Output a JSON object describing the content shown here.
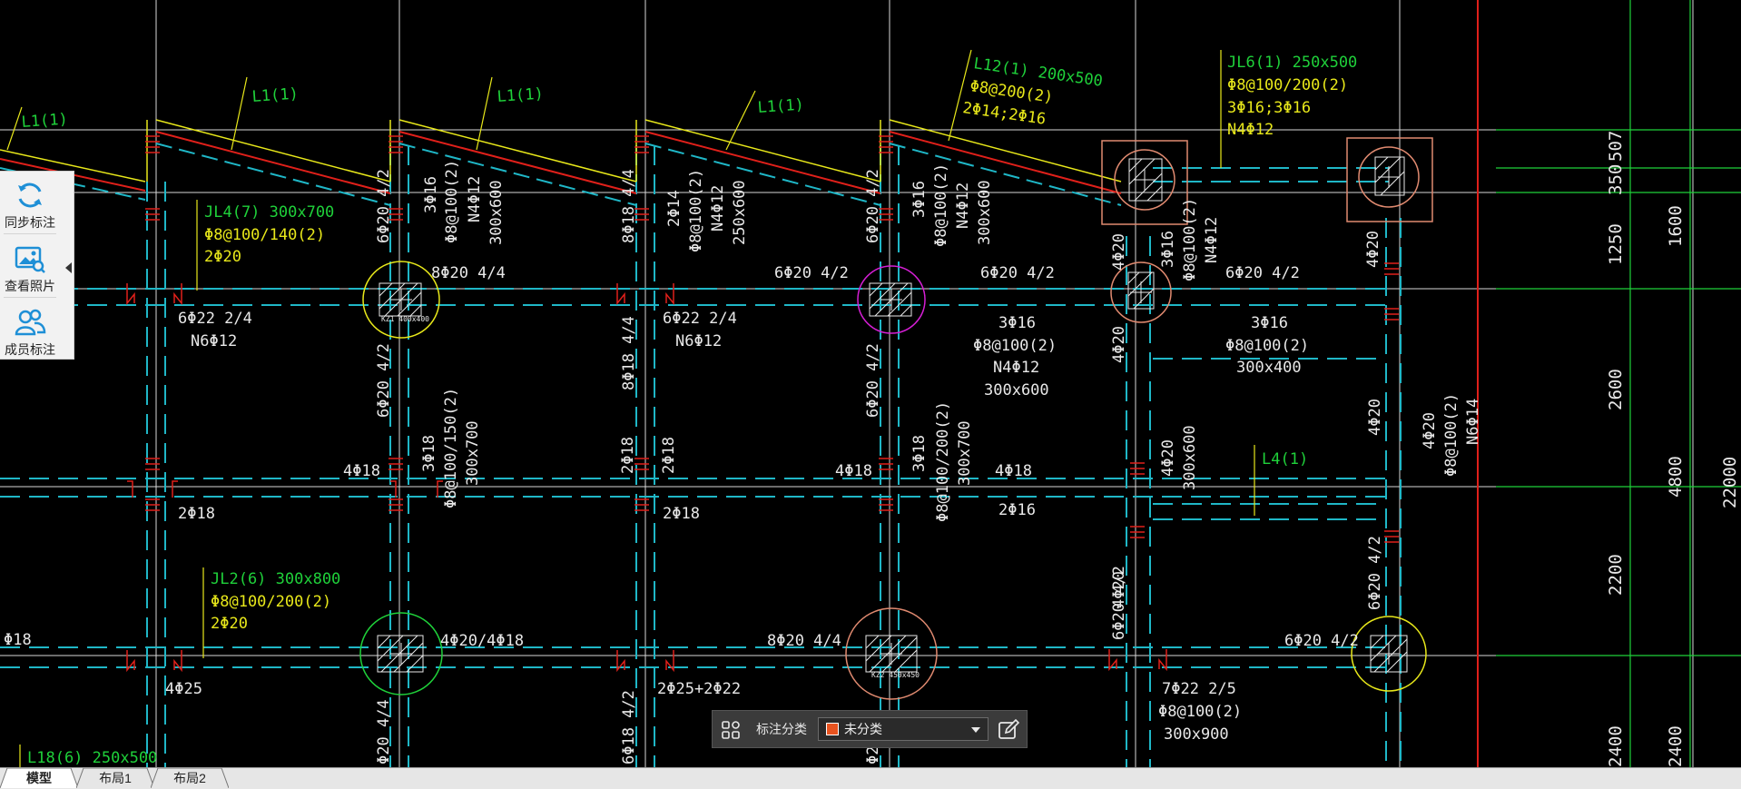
{
  "toolbar": {
    "sync_label": "同步标注",
    "photo_label": "查看照片",
    "member_label": "成员标注"
  },
  "tabs": [
    {
      "label": "模型",
      "active": true
    },
    {
      "label": "布局1",
      "active": false
    },
    {
      "label": "布局2",
      "active": false
    }
  ],
  "annotation_bar": {
    "label": "标注分类",
    "selected": "未分类",
    "swatch_color": "#e8531f"
  },
  "drawing": {
    "beam_tags": {
      "l1a": "L1(1)",
      "l1b": "L1(1)",
      "l1c": "L1(1)",
      "l1d": "L1(1)",
      "l12": [
        "L12(1) 200x500",
        "Φ8@200(2)",
        "2Φ14;2Φ16"
      ],
      "jl6": [
        "JL6(1) 250x500",
        "Φ8@100/200(2)",
        "3Φ16;3Φ16",
        "N4Φ12"
      ],
      "jl4": [
        "JL4(7) 300x700",
        "Φ8@100/140(2)",
        "2Φ20"
      ],
      "jl2": [
        "JL2(6) 300x800",
        "Φ8@100/200(2)",
        "2Φ20"
      ],
      "l4": "L4(1)",
      "l18": "L18(6) 250x500"
    },
    "labels": {
      "t1": "8Φ20 4/4",
      "t2": "6Φ20 4/2",
      "t3": "6Φ20 4/2",
      "t4": "6Φ20 4/2",
      "t5": "6Φ22 2/4",
      "t6": "N6Φ12",
      "t7": "6Φ22 2/4",
      "t8": "N6Φ12",
      "t9": "3Φ16",
      "t10": "Φ8@100(2)",
      "t11": "N4Φ12",
      "t12": "300x600",
      "t13": "3Φ16",
      "t14": "Φ8@100(2)",
      "t15": "300x400",
      "t16": "4Φ18",
      "t17": "2Φ18",
      "t18": "4Φ18",
      "t19": "2Φ18",
      "t20": "4Φ18",
      "t21": "2Φ16",
      "t22": "4Φ20/4Φ18",
      "t23": "8Φ20 4/4",
      "t24": "6Φ20 4/2",
      "t25": "4Φ25",
      "t26": "2Φ25+2Φ22",
      "t27": "7Φ22 2/5",
      "t28": "Φ8@100(2)",
      "t29": "300x900",
      "t30": "Φ18",
      "v1": "6Φ20 4/2",
      "v2": "3Φ16",
      "v3": "Φ8@100(2)",
      "v4": "N4Φ12",
      "v5": "300x600",
      "v6": "8Φ18 4/4",
      "v7": "2Φ14",
      "v8": "Φ8@100(2)",
      "v9": "N4Φ12",
      "v10": "250x600",
      "v11": "6Φ20 4/2",
      "v12": "3Φ16",
      "v13": "Φ8@100(2)",
      "v14": "N4Φ12",
      "v15": "300x600",
      "v16": "4Φ20",
      "v17": "3Φ16",
      "v18": "Φ8@100(2)",
      "v19": "N4Φ12",
      "v20": "4Φ20",
      "v21": "6Φ20 4/2",
      "v22": "8Φ18 4/4",
      "v23": "6Φ20 4/2",
      "v24": "3Φ18",
      "v25": "Φ8@100/150(2)",
      "v26": "300x700",
      "v27": "2Φ18",
      "v28": "2Φ18",
      "v29": "3Φ18",
      "v30": "Φ8@100/200(2)",
      "v31": "300x700",
      "v32": "4Φ20",
      "v33": "4Φ20",
      "v34": "300x600",
      "v35": "4Φ20",
      "v36": "4Φ20",
      "v37": "Φ8@100(2)",
      "v38": "N6Φ14",
      "v39": "6Φ20 4/2",
      "v40": "6Φ20 4/2",
      "v41": "Φ20 4/4",
      "v42": "6Φ18 4/2",
      "v43": "Φ2",
      "v44": "4Φ20"
    },
    "dimensions": {
      "d1": "350",
      "d2": "507",
      "d3": "1250",
      "d4": "1600",
      "d5": "2600",
      "d6": "4800",
      "d7": "2200",
      "d8": "2400",
      "d9": "2400",
      "d10": "22000"
    },
    "column_tags": {
      "c1": "KZ1 400x400",
      "c2": "KZ2 450x450"
    }
  }
}
